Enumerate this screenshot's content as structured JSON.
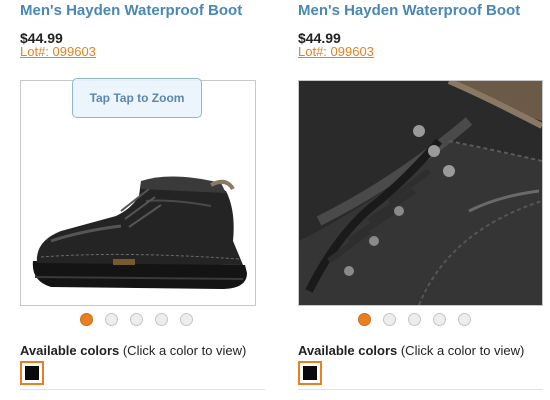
{
  "colors": {
    "title": "#4a87b4",
    "accent": "#e8801f",
    "swatch_black": "#0a0a0a"
  },
  "products": [
    {
      "title": "Men's Hayden Waterproof Boot",
      "price": "$44.99",
      "lot": "Lot#: 099603",
      "zoom_hint": "Tap Tap to Zoom",
      "image": {
        "icon": "boot-side-view-photo"
      },
      "carousel": {
        "total": 5,
        "active": 1
      },
      "colors_label": "Available colors",
      "colors_hint": " (Click a color to view)",
      "swatches": [
        "black"
      ]
    },
    {
      "title": "Men's Hayden Waterproof Boot",
      "price": "$44.99",
      "lot": "Lot#: 099603",
      "image": {
        "icon": "boot-closeup-laces-photo"
      },
      "carousel": {
        "total": 5,
        "active": 1
      },
      "colors_label": "Available colors",
      "colors_hint": " (Click a color to view)",
      "swatches": [
        "black"
      ]
    }
  ]
}
